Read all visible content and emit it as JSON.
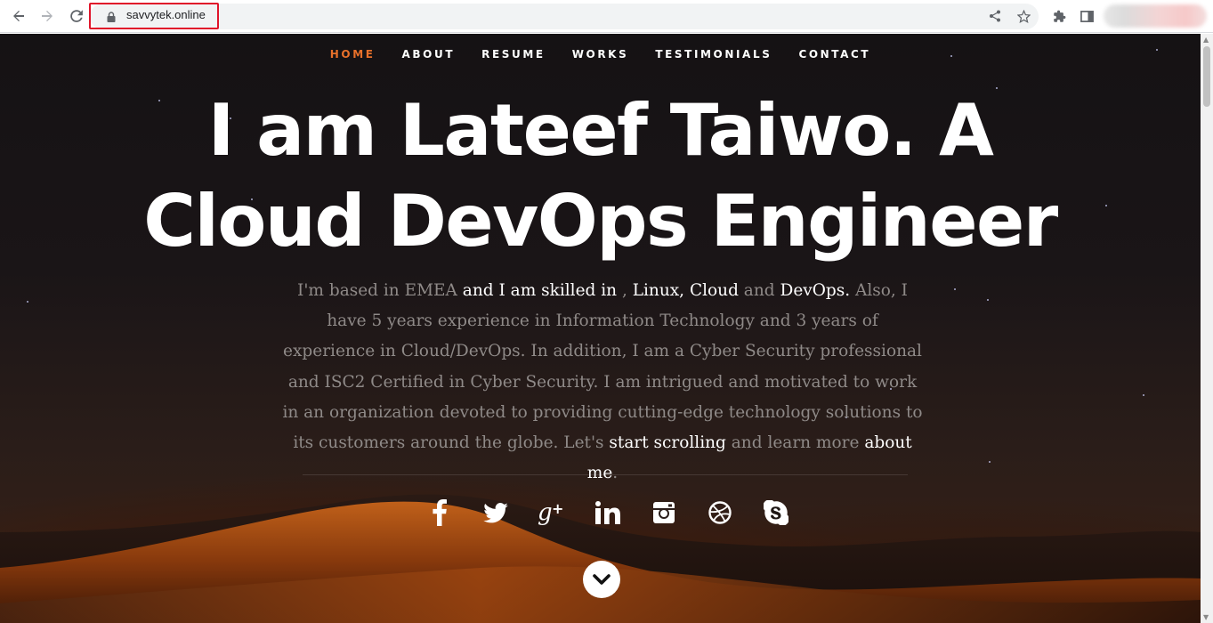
{
  "browser": {
    "url": "savvytek.online",
    "back_icon": "back-arrow-icon",
    "forward_icon": "forward-arrow-icon",
    "reload_icon": "reload-icon",
    "lock_icon": "lock-icon",
    "share_icon": "share-icon",
    "bookmark_icon": "star-icon",
    "extensions_icon": "puzzle-icon",
    "sidepanel_icon": "side-panel-icon",
    "highlight_color": "#e0142a"
  },
  "nav": {
    "items": [
      {
        "label": "HOME",
        "active": true
      },
      {
        "label": "ABOUT",
        "active": false
      },
      {
        "label": "RESUME",
        "active": false
      },
      {
        "label": "WORKS",
        "active": false
      },
      {
        "label": "TESTIMONIALS",
        "active": false
      },
      {
        "label": "CONTACT",
        "active": false
      }
    ],
    "active_color": "#e8702a"
  },
  "hero": {
    "headline_line1": "I am Lateef Taiwo. A",
    "headline_line2": "Cloud DevOps Engineer",
    "intro": {
      "p1": "I'm based in EMEA",
      "p2": " and I am skilled in ",
      "p3": ", ",
      "p4": "Linux, Cloud",
      "p5": " and ",
      "p6": "DevOps.",
      "p7": " Also, I have 5 years experience in Information Technology and 3 years of experience in Cloud/DevOps. In addition, I am a Cyber Security professional and ISC2 Certified in Cyber Security. I am intrigued and motivated to work in an organization devoted to providing cutting-edge technology solutions to its customers around the globe. Let's ",
      "p8": "start scrolling",
      "p9": " and learn more ",
      "p10": "about me",
      "p11": "."
    },
    "socials": [
      "facebook-icon",
      "twitter-icon",
      "google-plus-icon",
      "linkedin-icon",
      "instagram-icon",
      "dribbble-icon",
      "skype-icon"
    ],
    "scroll_down_icon": "chevron-down-icon"
  }
}
